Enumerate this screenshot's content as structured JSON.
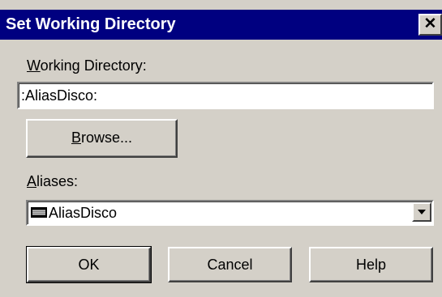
{
  "window": {
    "title": "Set Working Directory",
    "close_glyph": "✕"
  },
  "working_directory": {
    "label_accel": "W",
    "label_rest": "orking Directory:",
    "value": ":AliasDisco:"
  },
  "browse": {
    "label_accel": "B",
    "label_rest": "rowse..."
  },
  "aliases": {
    "label_accel": "A",
    "label_rest": "liases:",
    "selected": "AliasDisco",
    "icon": "drive-icon"
  },
  "buttons": {
    "ok": "OK",
    "cancel": "Cancel",
    "help": "Help"
  }
}
